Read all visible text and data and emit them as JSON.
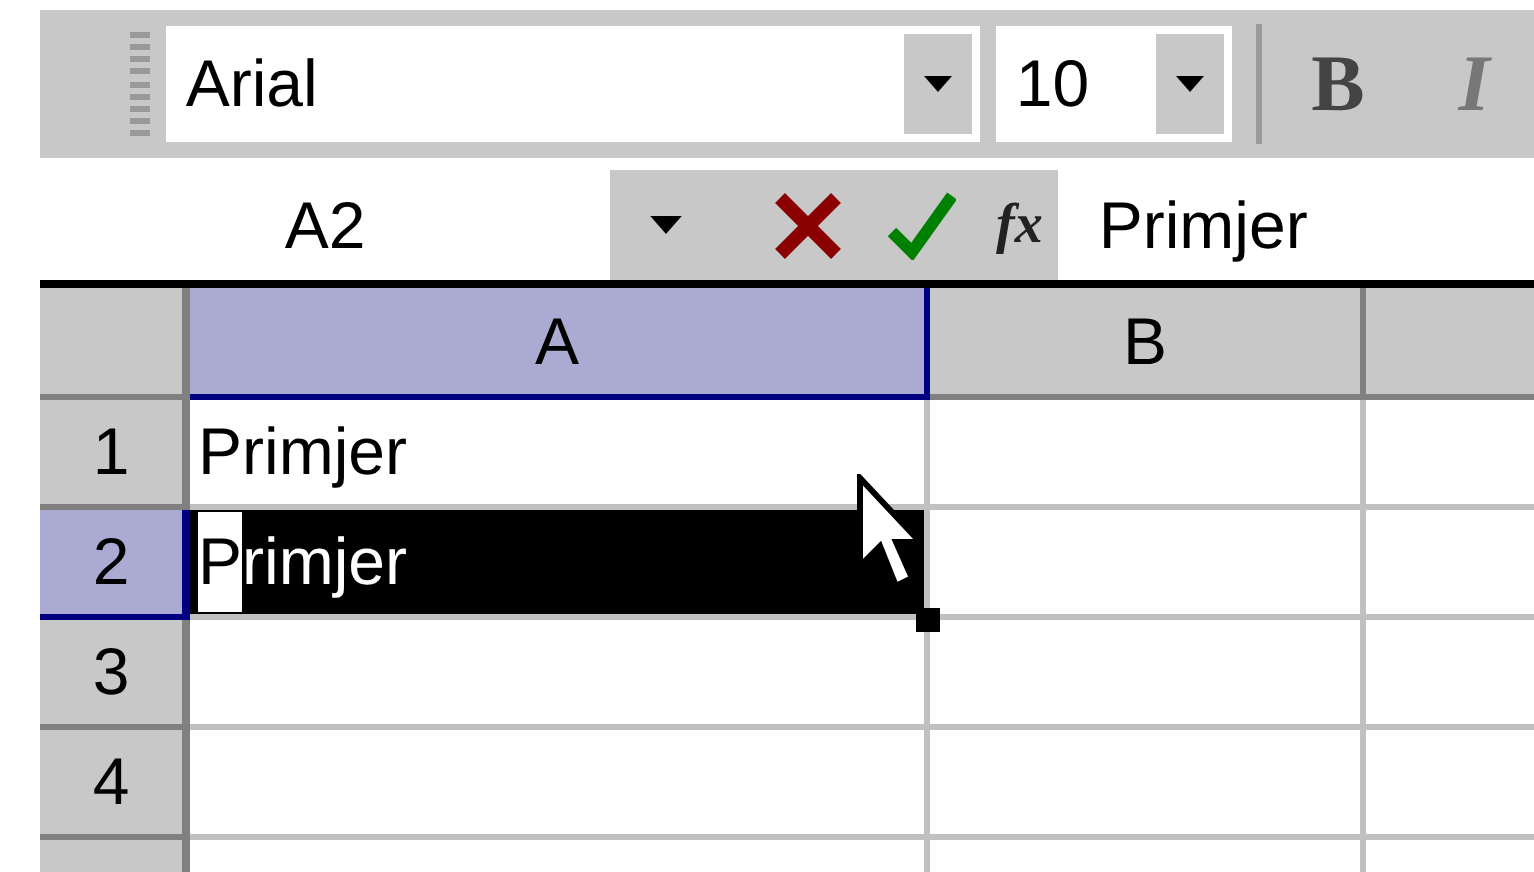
{
  "toolbar": {
    "font": "Arial",
    "size": "10",
    "buttons": [
      {
        "label": "B",
        "kind": "bold"
      },
      {
        "label": "I",
        "kind": "italic"
      }
    ]
  },
  "formula_bar": {
    "name_box": "A2",
    "function_label": "fx",
    "formula": "Primjer"
  },
  "grid": {
    "columns": [
      {
        "label": "A",
        "selected": true
      },
      {
        "label": "B",
        "selected": false
      },
      {
        "selected": false
      }
    ],
    "rows": [
      {
        "label": "1",
        "selected": false,
        "column_a": [
          {
            "text": "Primjer",
            "selected": false
          }
        ]
      },
      {
        "label": "2",
        "selected": true,
        "editing": true,
        "column_a": [
          {
            "text": "P",
            "selected": false
          },
          {
            "text": "rimjer",
            "selected": true
          }
        ]
      },
      {
        "label": "3",
        "selected": false
      },
      {
        "label": "4",
        "selected": false
      },
      {
        "selected": false
      }
    ]
  }
}
